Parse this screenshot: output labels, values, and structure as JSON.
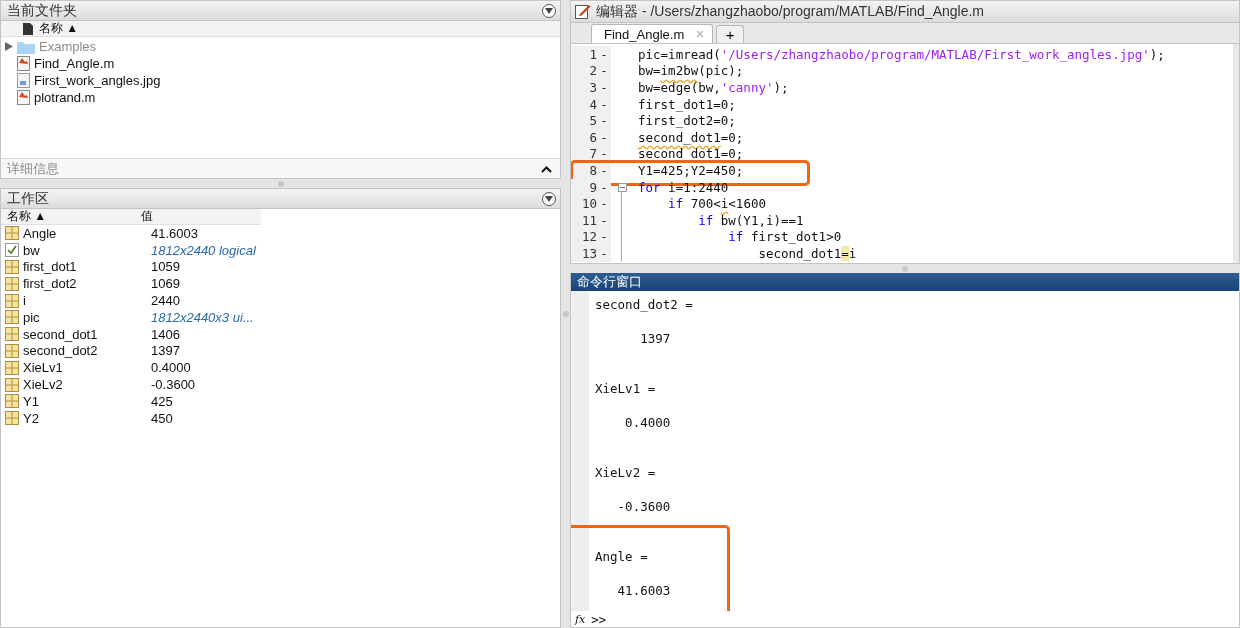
{
  "current_folder": {
    "title": "当前文件夹",
    "column": "名称 ▲",
    "items": [
      {
        "name": "Examples",
        "kind": "folder",
        "expanded": false,
        "dimmed": true
      },
      {
        "name": "Find_Angle.m",
        "kind": "mfile",
        "dimmed": false
      },
      {
        "name": "First_work_angles.jpg",
        "kind": "image",
        "dimmed": false
      },
      {
        "name": "plotrand.m",
        "kind": "mfile",
        "dimmed": false
      }
    ],
    "details": "详细信息"
  },
  "workspace": {
    "title": "工作区",
    "columns": [
      "名称 ▲",
      "值"
    ],
    "variables": [
      {
        "name": "Angle",
        "value": "41.6003",
        "kind": "array",
        "italic": false
      },
      {
        "name": "bw",
        "value": "1812x2440 logical",
        "kind": "logical",
        "italic": true
      },
      {
        "name": "first_dot1",
        "value": "1059",
        "kind": "array",
        "italic": false
      },
      {
        "name": "first_dot2",
        "value": "1069",
        "kind": "array",
        "italic": false
      },
      {
        "name": "i",
        "value": "2440",
        "kind": "array",
        "italic": false
      },
      {
        "name": "pic",
        "value": "1812x2440x3 ui...",
        "kind": "array",
        "italic": true
      },
      {
        "name": "second_dot1",
        "value": "1406",
        "kind": "array",
        "italic": false
      },
      {
        "name": "second_dot2",
        "value": "1397",
        "kind": "array",
        "italic": false
      },
      {
        "name": "XieLv1",
        "value": "0.4000",
        "kind": "array",
        "italic": false
      },
      {
        "name": "XieLv2",
        "value": "-0.3600",
        "kind": "array",
        "italic": false
      },
      {
        "name": "Y1",
        "value": "425",
        "kind": "array",
        "italic": false
      },
      {
        "name": "Y2",
        "value": "450",
        "kind": "array",
        "italic": false
      }
    ]
  },
  "editor": {
    "title": "编辑器 - /Users/zhangzhaobo/program/MATLAB/Find_Angle.m",
    "tabs": [
      {
        "label": "Find_Angle.m",
        "selected": true
      }
    ],
    "new_tab": "+",
    "lines": [
      {
        "number": "1",
        "marker": "-",
        "collapsible": false,
        "highlighted": false,
        "segments": [
          {
            "text": "pic=imread(",
            "kind": "plain"
          },
          {
            "text": "'/Users/zhangzhaobo/program/MATLAB/First_work_angles.jpg'",
            "kind": "string"
          },
          {
            "text": ");",
            "kind": "plain"
          }
        ]
      },
      {
        "number": "2",
        "marker": "-",
        "collapsible": false,
        "highlighted": false,
        "segments": [
          {
            "text": "bw=",
            "kind": "plain"
          },
          {
            "text": "im2bw",
            "kind": "warn"
          },
          {
            "text": "(pic);",
            "kind": "plain"
          }
        ]
      },
      {
        "number": "3",
        "marker": "-",
        "collapsible": false,
        "highlighted": false,
        "segments": [
          {
            "text": "bw=edge(bw,",
            "kind": "plain"
          },
          {
            "text": "'canny'",
            "kind": "string"
          },
          {
            "text": ");",
            "kind": "plain"
          }
        ]
      },
      {
        "number": "4",
        "marker": "-",
        "collapsible": false,
        "highlighted": false,
        "segments": [
          {
            "text": "first_dot1=0;",
            "kind": "plain"
          }
        ]
      },
      {
        "number": "5",
        "marker": "-",
        "collapsible": false,
        "highlighted": false,
        "segments": [
          {
            "text": "first_dot2=0;",
            "kind": "plain"
          }
        ]
      },
      {
        "number": "6",
        "marker": "-",
        "collapsible": false,
        "highlighted": false,
        "segments": [
          {
            "text": "second_dot1",
            "kind": "warn"
          },
          {
            "text": "=0;",
            "kind": "plain"
          }
        ]
      },
      {
        "number": "7",
        "marker": "-",
        "collapsible": false,
        "highlighted": false,
        "segments": [
          {
            "text": "second_dot1=0;",
            "kind": "plain"
          }
        ]
      },
      {
        "number": "8",
        "marker": "-",
        "collapsible": false,
        "highlighted": true,
        "segments": [
          {
            "text": "Y1=425;Y2=450;",
            "kind": "plain"
          }
        ]
      },
      {
        "number": "9",
        "marker": "-",
        "collapsible": true,
        "highlighted": false,
        "segments": [
          {
            "text": "for",
            "kind": "keyword"
          },
          {
            "text": " i=1:2440",
            "kind": "plain"
          }
        ]
      },
      {
        "number": "10",
        "marker": "-",
        "collapsible": false,
        "highlighted": false,
        "segments": [
          {
            "text": "    if",
            "kind": "keyword"
          },
          {
            "text": " 700<",
            "kind": "plain"
          },
          {
            "text": "i",
            "kind": "warn"
          },
          {
            "text": "<1600",
            "kind": "plain"
          }
        ]
      },
      {
        "number": "11",
        "marker": "-",
        "collapsible": false,
        "highlighted": false,
        "segments": [
          {
            "text": "        if",
            "kind": "keyword"
          },
          {
            "text": " bw(Y1,i)==1",
            "kind": "plain"
          }
        ]
      },
      {
        "number": "12",
        "marker": "-",
        "collapsible": false,
        "highlighted": false,
        "segments": [
          {
            "text": "            if",
            "kind": "keyword"
          },
          {
            "text": " first_dot1>0",
            "kind": "plain"
          }
        ]
      },
      {
        "number": "13",
        "marker": "-",
        "collapsible": false,
        "highlighted": false,
        "segments": [
          {
            "text": "                second_dot1",
            "kind": "plain"
          },
          {
            "text": "=",
            "kind": "match"
          },
          {
            "text": "i",
            "kind": "plain"
          }
        ]
      }
    ]
  },
  "command_window": {
    "title": "命令行窗口",
    "outputs": [
      {
        "name": "second_dot2 =",
        "value": "      1397",
        "highlighted": false
      },
      {
        "name": "XieLv1 =",
        "value": "    0.4000",
        "highlighted": false
      },
      {
        "name": "XieLv2 =",
        "value": "   -0.3600",
        "highlighted": false
      },
      {
        "name": "Angle =",
        "value": "   41.6003",
        "highlighted": true
      }
    ],
    "function_icon": "fx",
    "prompt": ">>"
  }
}
